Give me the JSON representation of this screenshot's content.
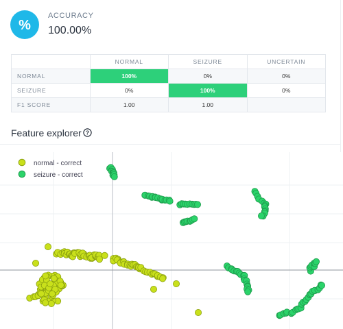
{
  "accuracy": {
    "label": "ACCURACY",
    "value": "100.00%",
    "icon": "percent-icon"
  },
  "confusion_matrix": {
    "columns": [
      "NORMAL",
      "SEIZURE",
      "UNCERTAIN"
    ],
    "rows": [
      {
        "label": "NORMAL",
        "cells": [
          "100%",
          "0%",
          "0%"
        ]
      },
      {
        "label": "SEIZURE",
        "cells": [
          "0%",
          "100%",
          "0%"
        ]
      },
      {
        "label": "F1 SCORE",
        "cells": [
          "1.00",
          "1.00",
          ""
        ]
      }
    ],
    "highlight_color": "#2dd07a"
  },
  "feature_explorer": {
    "title": "Feature explorer",
    "icon": "help-circle-icon",
    "legend": [
      {
        "label": "normal - correct",
        "color": "#c9e01b"
      },
      {
        "label": "seizure - correct",
        "color": "#2bd36a"
      }
    ]
  }
}
